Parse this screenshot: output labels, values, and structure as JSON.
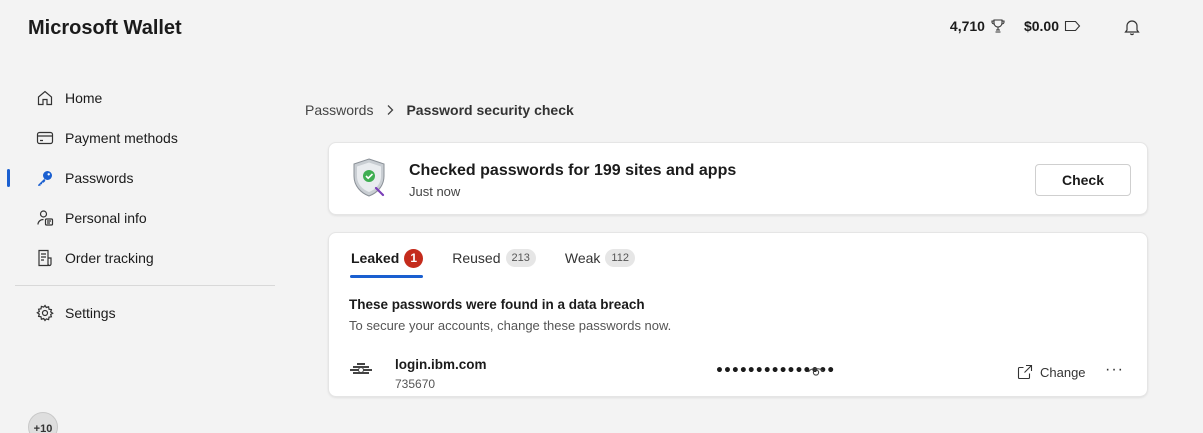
{
  "app": {
    "title": "Microsoft Wallet"
  },
  "topbar": {
    "rewards_points": "4,710",
    "rewards_icon": "trophy-icon",
    "balance": "$0.00",
    "balance_icon": "tag-icon",
    "notifications_icon": "bell-icon"
  },
  "sidebar": {
    "items": [
      {
        "label": "Home",
        "icon": "home-icon"
      },
      {
        "label": "Payment methods",
        "icon": "card-icon"
      },
      {
        "label": "Passwords",
        "icon": "key-icon",
        "active": true
      },
      {
        "label": "Personal info",
        "icon": "person-icon"
      },
      {
        "label": "Order tracking",
        "icon": "receipt-icon"
      }
    ],
    "settings": {
      "label": "Settings",
      "icon": "gear-icon"
    },
    "avatar_badge": "+10"
  },
  "breadcrumb": {
    "parent": "Passwords",
    "current": "Password security check"
  },
  "check_card": {
    "title": "Checked passwords for 199 sites and apps",
    "subtitle": "Just now",
    "button": "Check"
  },
  "tabs": [
    {
      "label": "Leaked",
      "count": "1",
      "active": true
    },
    {
      "label": "Reused",
      "count": "213"
    },
    {
      "label": "Weak",
      "count": "112"
    }
  ],
  "breach": {
    "title": "These passwords were found in a data breach",
    "subtitle": "To secure your accounts, change these passwords now."
  },
  "entries": [
    {
      "site": "login.ibm.com",
      "username": "735670",
      "password_mask": "•••••••••••••••",
      "change_label": "Change",
      "more_label": "···"
    }
  ],
  "colors": {
    "accent": "#1a5fd0",
    "alert": "#c42b1c"
  }
}
